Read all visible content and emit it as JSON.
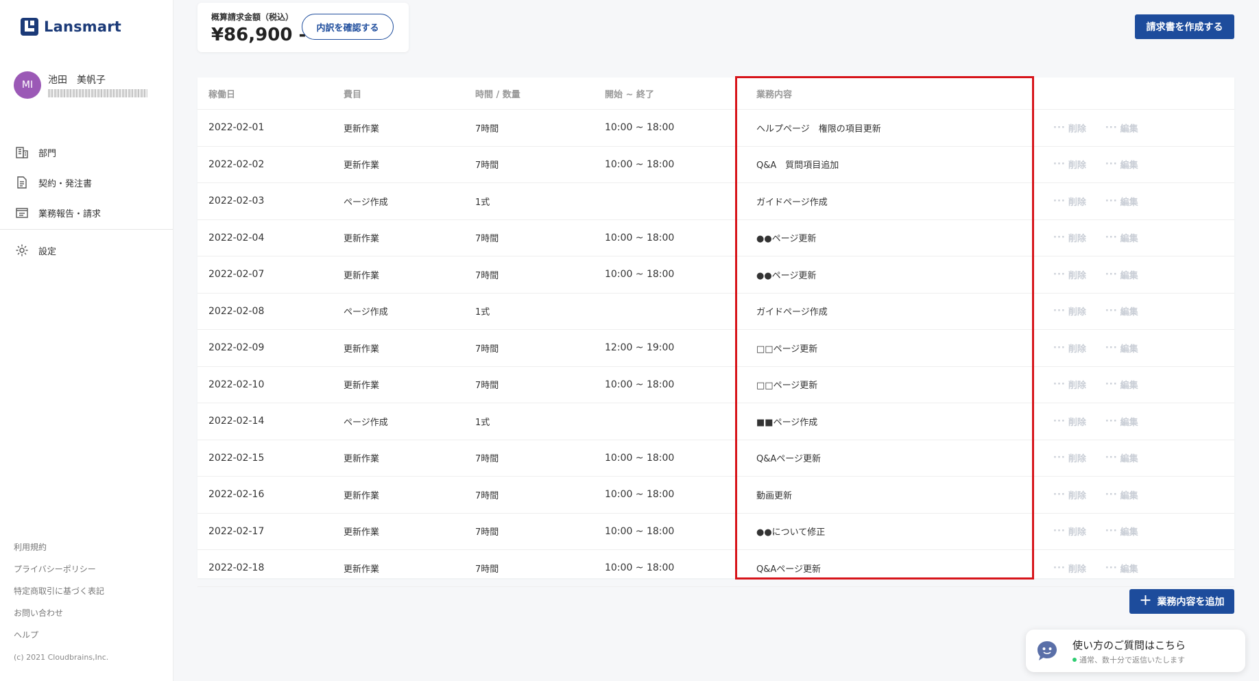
{
  "brand": {
    "name": "Lansmart",
    "color": "#1b3a78"
  },
  "user": {
    "initials": "MI",
    "name": "池田　美帆子",
    "avatar_color": "#9b59b6"
  },
  "nav": {
    "items": [
      {
        "label": "部門",
        "icon": "building-icon"
      },
      {
        "label": "契約・発注書",
        "icon": "document-icon"
      },
      {
        "label": "業務報告・請求",
        "icon": "report-icon"
      }
    ],
    "settings": {
      "label": "設定",
      "icon": "gear-icon"
    }
  },
  "footer": {
    "links": [
      "利用規約",
      "プライバシーポリシー",
      "特定商取引に基づく表記",
      "お問い合わせ",
      "ヘルプ"
    ],
    "copyright": "(c) 2021 Cloudbrains,Inc."
  },
  "summary": {
    "label": "概算請求金額（税込）",
    "amount": "¥86,900 -",
    "detail_button": "内訳を確認する"
  },
  "toolbar": {
    "create_invoice": "請求書を作成する"
  },
  "table": {
    "headers": {
      "date": "稼働日",
      "item": "費目",
      "qty": "時間 / 数量",
      "time": "開始 ~ 終了",
      "work": "業務内容"
    },
    "actions": {
      "delete": "削除",
      "edit": "編集",
      "dots": "···"
    },
    "rows": [
      {
        "date": "2022-02-01",
        "item": "更新作業",
        "qty": "7時間",
        "time": "10:00 ~ 18:00",
        "work": "ヘルプページ　権限の項目更新"
      },
      {
        "date": "2022-02-02",
        "item": "更新作業",
        "qty": "7時間",
        "time": "10:00 ~ 18:00",
        "work": "Q&A　質問項目追加"
      },
      {
        "date": "2022-02-03",
        "item": "ページ作成",
        "qty": "1式",
        "time": "",
        "work": "ガイドページ作成"
      },
      {
        "date": "2022-02-04",
        "item": "更新作業",
        "qty": "7時間",
        "time": "10:00 ~ 18:00",
        "work": "●●ページ更新"
      },
      {
        "date": "2022-02-07",
        "item": "更新作業",
        "qty": "7時間",
        "time": "10:00 ~ 18:00",
        "work": "●●ページ更新"
      },
      {
        "date": "2022-02-08",
        "item": "ページ作成",
        "qty": "1式",
        "time": "",
        "work": "ガイドページ作成"
      },
      {
        "date": "2022-02-09",
        "item": "更新作業",
        "qty": "7時間",
        "time": "12:00 ~ 19:00",
        "work": "□□ページ更新"
      },
      {
        "date": "2022-02-10",
        "item": "更新作業",
        "qty": "7時間",
        "time": "10:00 ~ 18:00",
        "work": "□□ページ更新"
      },
      {
        "date": "2022-02-14",
        "item": "ページ作成",
        "qty": "1式",
        "time": "",
        "work": "■■ページ作成"
      },
      {
        "date": "2022-02-15",
        "item": "更新作業",
        "qty": "7時間",
        "time": "10:00 ~ 18:00",
        "work": "Q&Aページ更新"
      },
      {
        "date": "2022-02-16",
        "item": "更新作業",
        "qty": "7時間",
        "time": "10:00 ~ 18:00",
        "work": "動画更新"
      },
      {
        "date": "2022-02-17",
        "item": "更新作業",
        "qty": "7時間",
        "time": "10:00 ~ 18:00",
        "work": "●●について修正"
      },
      {
        "date": "2022-02-18",
        "item": "更新作業",
        "qty": "7時間",
        "time": "10:00 ~ 18:00",
        "work": "Q&Aページ更新"
      }
    ]
  },
  "add_button": {
    "label": "業務内容を追加",
    "icon": "plus-icon"
  },
  "chat": {
    "title": "使い方のご質問はこちら",
    "subtitle": "通常、数十分で返信いたします",
    "icon": "chat-bot-icon"
  },
  "colors": {
    "primary": "#1d4c9c",
    "highlight": "#d7141a",
    "status_online": "#2ecc71"
  }
}
